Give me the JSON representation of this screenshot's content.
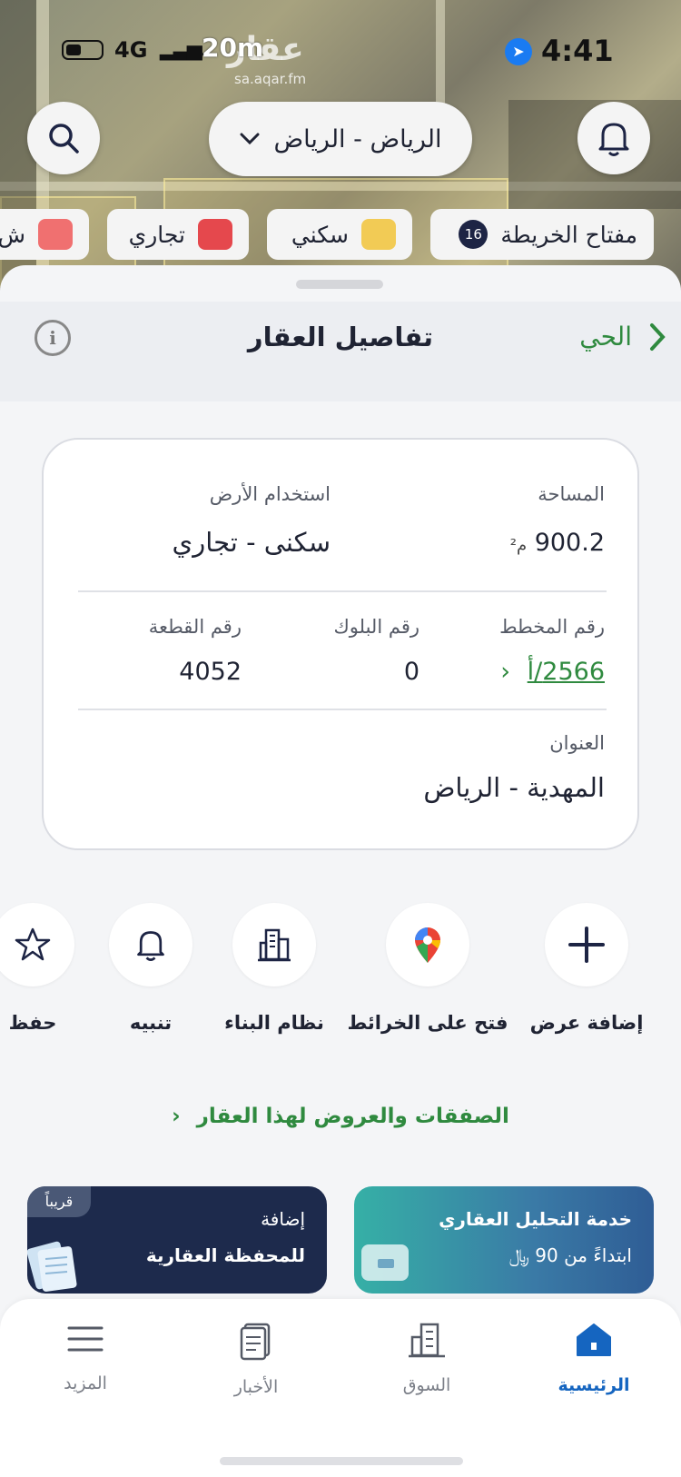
{
  "status_bar": {
    "network": "4G",
    "recording": "20m",
    "time": "4:41"
  },
  "map": {
    "watermark": "عقار",
    "watermark_url": "sa.aqar.fm"
  },
  "top_bar": {
    "city_selector": "الرياض - الرياض"
  },
  "legend": {
    "key_label": "مفتاح الخريطة",
    "key_count": "16",
    "items": [
      {
        "label": "سكني",
        "color": "#f2cb55"
      },
      {
        "label": "تجاري",
        "color": "#e5484d"
      },
      {
        "label": "ش",
        "color": "#f07070"
      }
    ]
  },
  "sheet": {
    "title": "تفاصيل العقار",
    "back_label": "الحي"
  },
  "details": {
    "area_label": "المساحة",
    "area_value": "900.2",
    "area_unit": "م²",
    "land_use_label": "استخدام الأرض",
    "land_use_value": "سكنى - تجاري",
    "plan_label": "رقم المخطط",
    "plan_value": "2566/أ",
    "block_label": "رقم البلوك",
    "block_value": "0",
    "parcel_label": "رقم القطعة",
    "parcel_value": "4052",
    "address_label": "العنوان",
    "address_value": "المهدية - الرياض"
  },
  "actions": [
    {
      "label": "إضافة عرض",
      "icon": "plus-icon"
    },
    {
      "label": "فتح على الخرائط",
      "icon": "map-pin-icon"
    },
    {
      "label": "نظام البناء",
      "icon": "building-icon"
    },
    {
      "label": "تنبيه",
      "icon": "bell-icon"
    },
    {
      "label": "حفظ",
      "icon": "star-icon"
    }
  ],
  "deals_link": "الصفقات والعروض لهذا العقار",
  "promos": {
    "analysis": {
      "line1": "خدمة التحليل العقاري",
      "line2": "ابتداءً من 90 ﷼"
    },
    "portfolio": {
      "line1": "إضافة",
      "line2": "للمحفظة العقارية",
      "badge": "قريباً"
    }
  },
  "tabs": [
    {
      "label": "الرئيسية",
      "icon": "home-icon",
      "active": true
    },
    {
      "label": "السوق",
      "icon": "market-building-icon"
    },
    {
      "label": "الأخبار",
      "icon": "news-icon"
    },
    {
      "label": "المزيد",
      "icon": "menu-icon"
    }
  ],
  "colors": {
    "accent_green": "#2f8a3f",
    "active_blue": "#1565c0",
    "navy": "#1d2444"
  }
}
